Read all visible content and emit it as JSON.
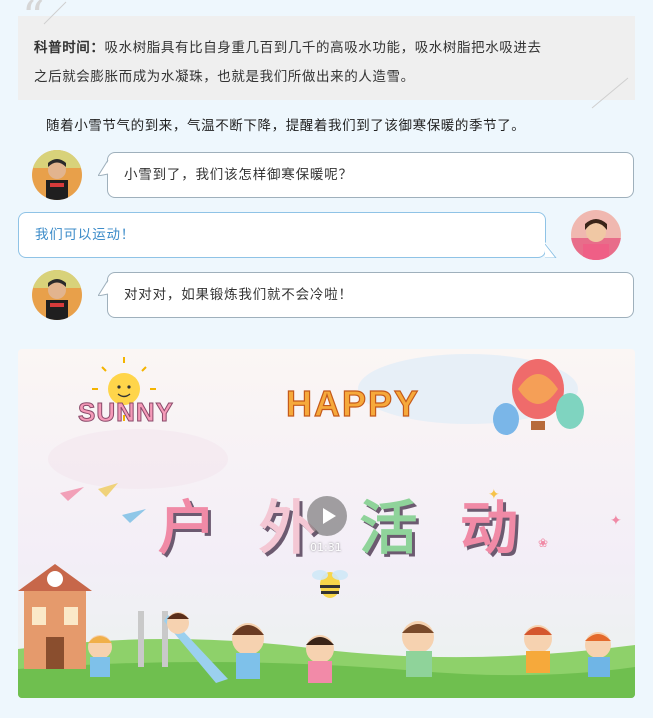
{
  "info": {
    "label": "科普时间：",
    "line1": "吸水树脂具有比自身重几百到几千的高吸水功能，吸水树脂把水吸进去",
    "line2": "之后就会膨胀而成为水凝珠，也就是我们所做出来的人造雪。"
  },
  "intro": "随着小雪节气的到来，气温不断下降，提醒着我们到了该御寒保暖的季节了。",
  "chat": [
    {
      "side": "left",
      "text": "小雪到了，我们该怎样御寒保暖呢？"
    },
    {
      "side": "right",
      "text": "我们可以运动！"
    },
    {
      "side": "left",
      "text": "对对对，如果锻炼我们就不会冷啦！"
    }
  ],
  "video": {
    "sun_text": "SUNNY",
    "happy_text": "HAPPY",
    "title_chars": [
      "户",
      "外",
      "活",
      "动"
    ],
    "duration": "01:31",
    "colors": {
      "title_pink": "#f08aa6",
      "title_green": "#8fd39a",
      "grass": "#8ed16a",
      "sky": "#f6f3f8"
    }
  }
}
